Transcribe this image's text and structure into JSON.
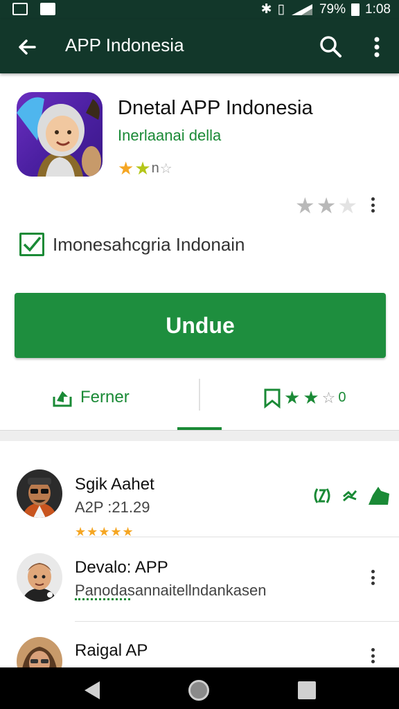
{
  "status_bar": {
    "battery_percent": "79%",
    "time": "1:08"
  },
  "toolbar": {
    "title": "APP Indonesia",
    "back_icon": "arrow-back-icon",
    "search_icon": "search-icon",
    "more_icon": "more-vert-icon"
  },
  "app": {
    "title": "Dnetal APP Indonesia",
    "developer": "Inerlaanai della",
    "rating_stars": 2,
    "rating_suffix": "n"
  },
  "checkbox": {
    "label": "Imonesahcgria Indonain",
    "checked": true
  },
  "install": {
    "label": "Undue",
    "color": "#1e8e3e"
  },
  "actions": {
    "share_label": "Ferner",
    "wishlist_suffix": "0"
  },
  "list": {
    "items": [
      {
        "title": "Sgik Aahet",
        "subtitle": "A2P :21.29",
        "stars": "★★★★★"
      },
      {
        "title": "Devalo: APP",
        "subtitle": "Panodasannaitellndankasen"
      },
      {
        "title": "Raigal AP"
      }
    ]
  },
  "colors": {
    "toolbar_bg": "#12372a",
    "accent_green": "#1a8a36",
    "star_gold": "#f5a623"
  }
}
